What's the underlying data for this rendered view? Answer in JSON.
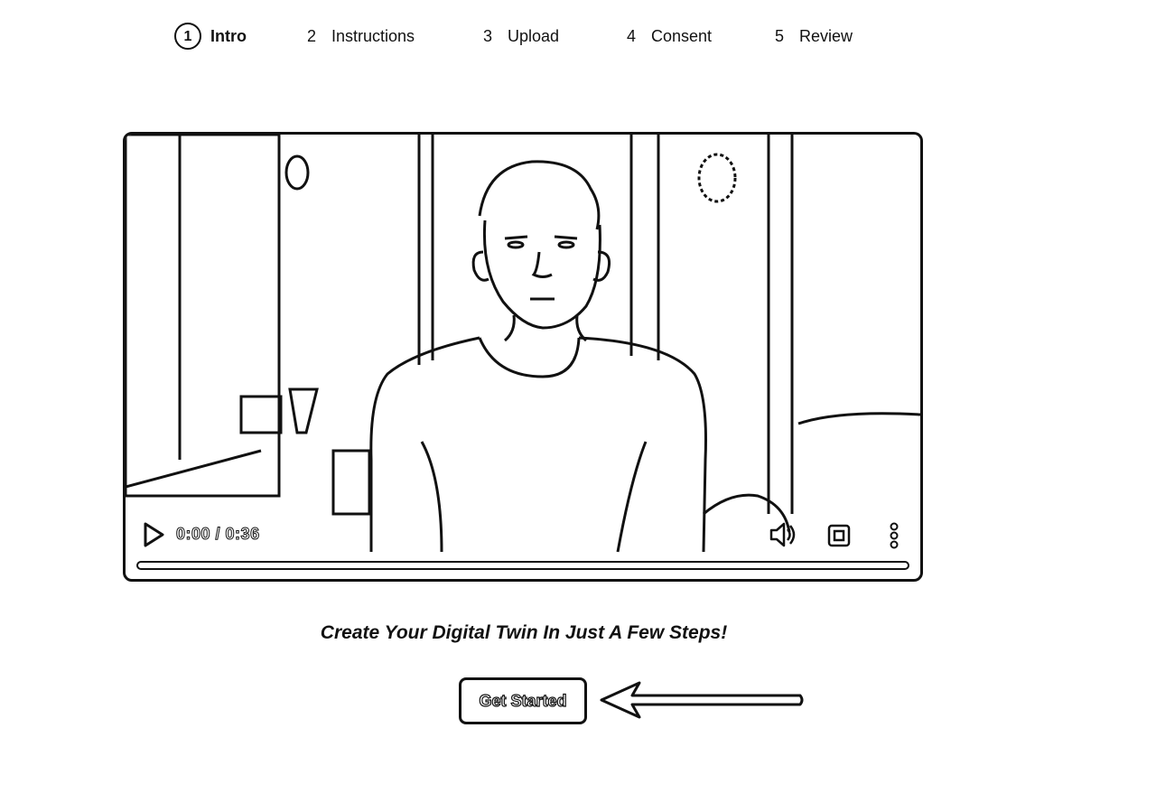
{
  "stepper": {
    "steps": [
      {
        "number": "1",
        "label": "Intro",
        "active": true
      },
      {
        "number": "2",
        "label": "Instructions",
        "active": false
      },
      {
        "number": "3",
        "label": "Upload",
        "active": false
      },
      {
        "number": "4",
        "label": "Consent",
        "active": false
      },
      {
        "number": "5",
        "label": "Review",
        "active": false
      }
    ]
  },
  "video": {
    "current_time": "0:00",
    "separator": " / ",
    "duration": "0:36",
    "progress": 0,
    "icons": {
      "play": "play-icon",
      "volume": "volume-icon",
      "pip": "picture-in-picture-icon",
      "more": "more-vertical-icon"
    }
  },
  "tagline": "Create Your Digital Twin In Just A Few Steps!",
  "cta": {
    "label": "Get Started"
  },
  "colors": {
    "ink": "#111111",
    "background": "#ffffff"
  }
}
